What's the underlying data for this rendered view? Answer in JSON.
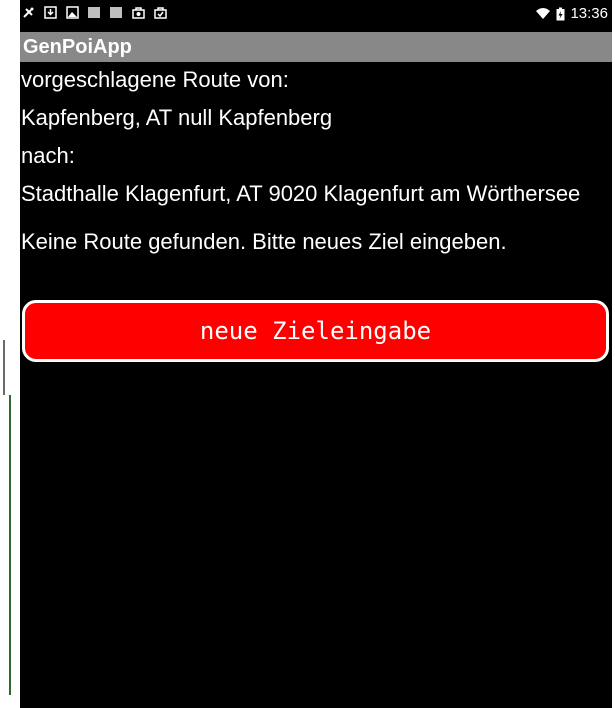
{
  "statusbar": {
    "clock": "13:36",
    "icons_left": [
      "satellite-icon",
      "download-icon",
      "image-icon",
      "barcode-icon",
      "barcode-icon",
      "bag-icon",
      "bag-check-icon"
    ],
    "icons_right": [
      "wifi-icon",
      "battery-icon"
    ]
  },
  "app": {
    "title": "GenPoiApp"
  },
  "route": {
    "from_label": "vorgeschlagene Route von:",
    "from_value": "Kapfenberg, AT null Kapfenberg",
    "to_label": "nach:",
    "to_value": "Stadthalle Klagenfurt, AT 9020 Klagenfurt am Wörthersee",
    "message": "Keine Route gefunden. Bitte neues Ziel eingeben."
  },
  "actions": {
    "new_target_label": "neue Zieleingabe"
  },
  "colors": {
    "button_background": "#ff0000",
    "titlebar": "#888888",
    "screen_background": "#000000"
  }
}
